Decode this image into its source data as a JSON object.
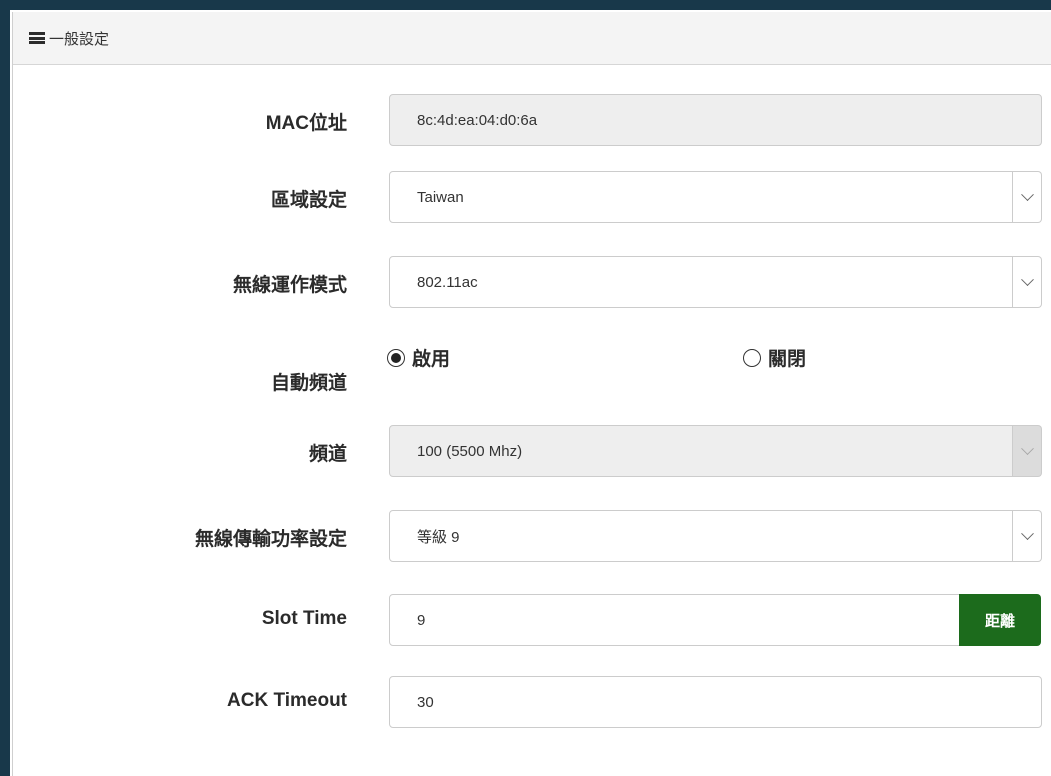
{
  "panel": {
    "title": "一般設定",
    "icon": "list-icon"
  },
  "form": {
    "mac": {
      "label": "MAC位址",
      "value": "8c:4d:ea:04:d0:6a"
    },
    "region": {
      "label": "區域設定",
      "value": "Taiwan"
    },
    "wireless_mode": {
      "label": "無線運作模式",
      "value": "802.11ac"
    },
    "auto_channel": {
      "label": "自動頻道",
      "options": [
        {
          "label": "啟用",
          "selected": true
        },
        {
          "label": "關閉",
          "selected": false
        }
      ]
    },
    "channel": {
      "label": "頻道",
      "value": "100 (5500 Mhz)",
      "disabled": true
    },
    "tx_power": {
      "label": "無線傳輸功率設定",
      "value": "等級 9"
    },
    "slot_time": {
      "label": "Slot Time",
      "value": "9",
      "button_label": "距離"
    },
    "ack_timeout": {
      "label": "ACK Timeout",
      "value": "30"
    }
  },
  "colors": {
    "frame": "#18384a",
    "button": "#1c6b1c",
    "readonly_bg": "#eeeeee"
  }
}
